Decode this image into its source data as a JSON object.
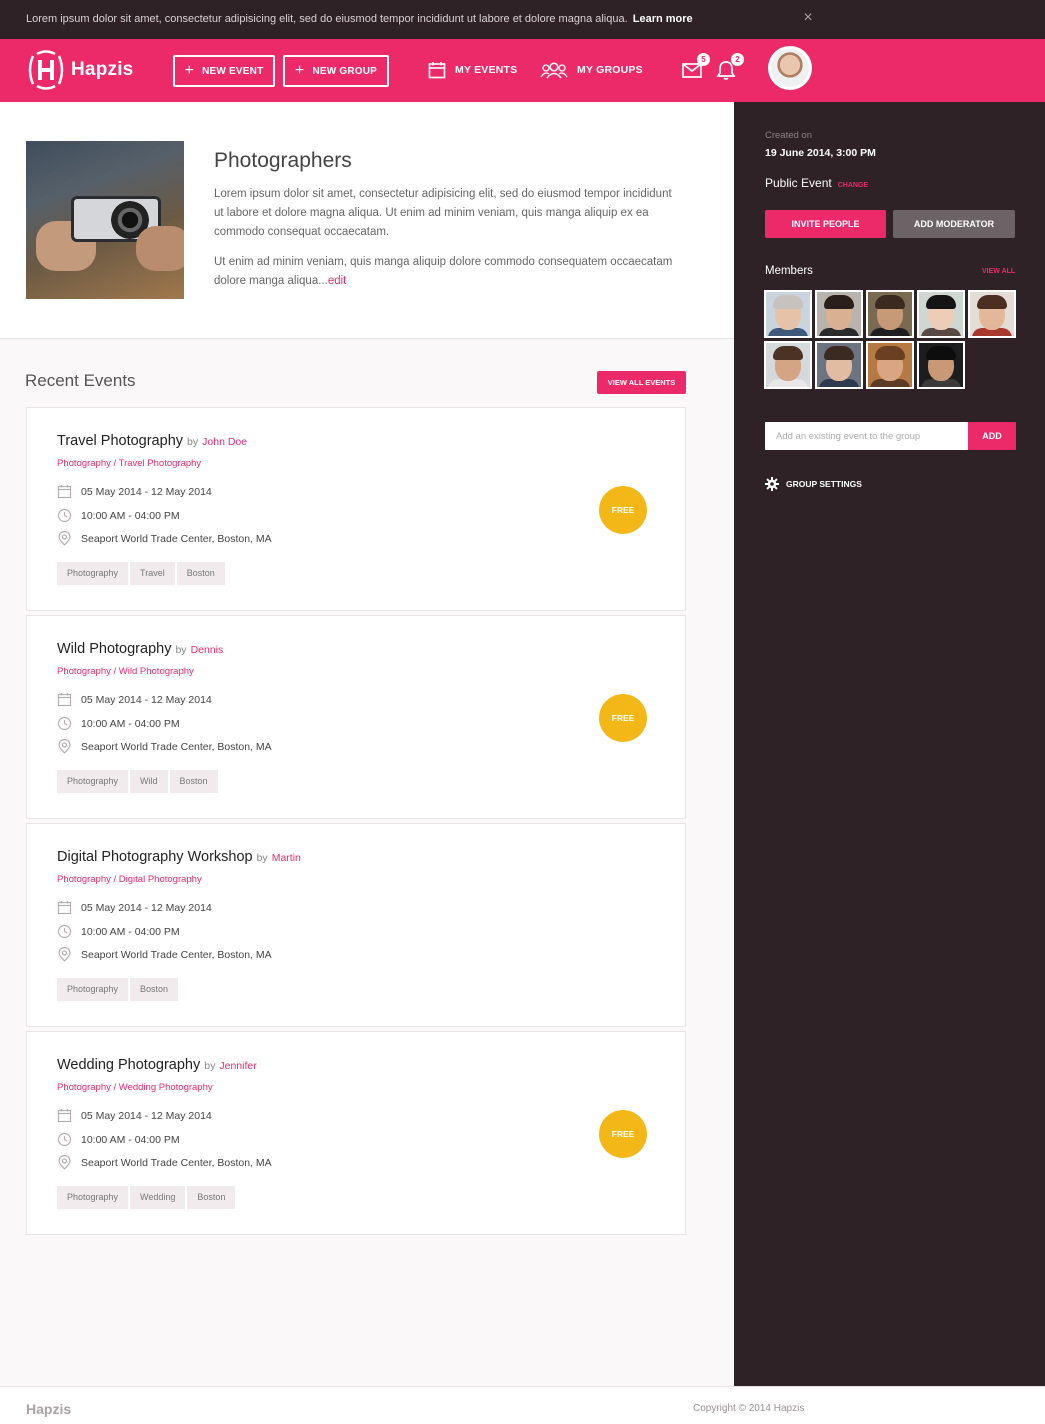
{
  "notice": {
    "text": "Lorem ipsum dolor sit amet, consectetur adipisicing elit, sed do eiusmod tempor incididunt ut labore et dolore magna aliqua.",
    "link": "Learn more",
    "close_icon": "×"
  },
  "header": {
    "brand": "Hapzis",
    "new_event": "NEW EVENT",
    "new_group": "NEW GROUP",
    "my_events": "MY EVENTS",
    "my_groups": "MY GROUPS",
    "messages_count": "5",
    "notifications_count": "2",
    "accent_color": "#ec2a6a"
  },
  "group": {
    "title": "Photographers",
    "description": "Lorem ipsum dolor sit amet, consectetur adipisicing elit, sed do eiusmod tempor incididunt ut labore et dolore magna aliqua. Ut enim ad minim veniam, quis manga aliquip ex ea commodo consequat occaecatam.",
    "description2": "Ut enim ad minim veniam, quis manga aliquip dolore commodo consequatem occaecatam dolore manga aliqua...",
    "edit_link": "edit"
  },
  "recent": {
    "title": "Recent Events",
    "view_all": "VIEW ALL EVENTS",
    "by_word": "by",
    "events": [
      {
        "title": "Travel Photography",
        "author": "John Doe",
        "category": "Photography / Travel Photography",
        "date": "05 May 2014 - 12 May 2014",
        "time": "10:00 AM - 04:00 PM",
        "location": "Seaport World Trade Center, Boston, MA",
        "tags": [
          "Photography",
          "Travel",
          "Boston"
        ],
        "price": "FREE"
      },
      {
        "title": "Wild Photography",
        "author": "Dennis",
        "category": "Photography / Wild Photography",
        "date": "05 May 2014 - 12 May 2014",
        "time": "10:00 AM - 04:00 PM",
        "location": "Seaport World Trade Center, Boston, MA",
        "tags": [
          "Photography",
          "Wild",
          "Boston"
        ],
        "price": "FREE"
      },
      {
        "title": "Digital Photography Workshop",
        "author": "Martin",
        "category": "Photography / Digital Photography",
        "date": "05 May 2014 - 12 May 2014",
        "time": "10:00 AM - 04:00 PM",
        "location": "Seaport World Trade Center, Boston, MA",
        "tags": [
          "Photography",
          "Boston"
        ],
        "price": ""
      },
      {
        "title": "Wedding Photography",
        "author": "Jennifer",
        "category": "Photography / Wedding Photography",
        "date": "05 May 2014 - 12 May 2014",
        "time": "10:00 AM - 04:00 PM",
        "location": "Seaport World Trade Center, Boston, MA",
        "tags": [
          "Photography",
          "Wedding",
          "Boston"
        ],
        "price": "FREE"
      }
    ]
  },
  "sidebar": {
    "created_label": "Created on",
    "created_value": "19 June 2014, 3:00 PM",
    "visibility": "Public Event",
    "change": "CHANGE",
    "invite": "INVITE PEOPLE",
    "add_moderator": "ADD MODERATOR",
    "members_title": "Members",
    "view_all": "VIEW ALL",
    "add_placeholder": "Add an existing event to the group",
    "add_button": "ADD",
    "group_settings": "GROUP SETTINGS"
  },
  "footer": {
    "brand": "Hapzis",
    "copyright": "Copyright © 2014 Hapzis"
  }
}
